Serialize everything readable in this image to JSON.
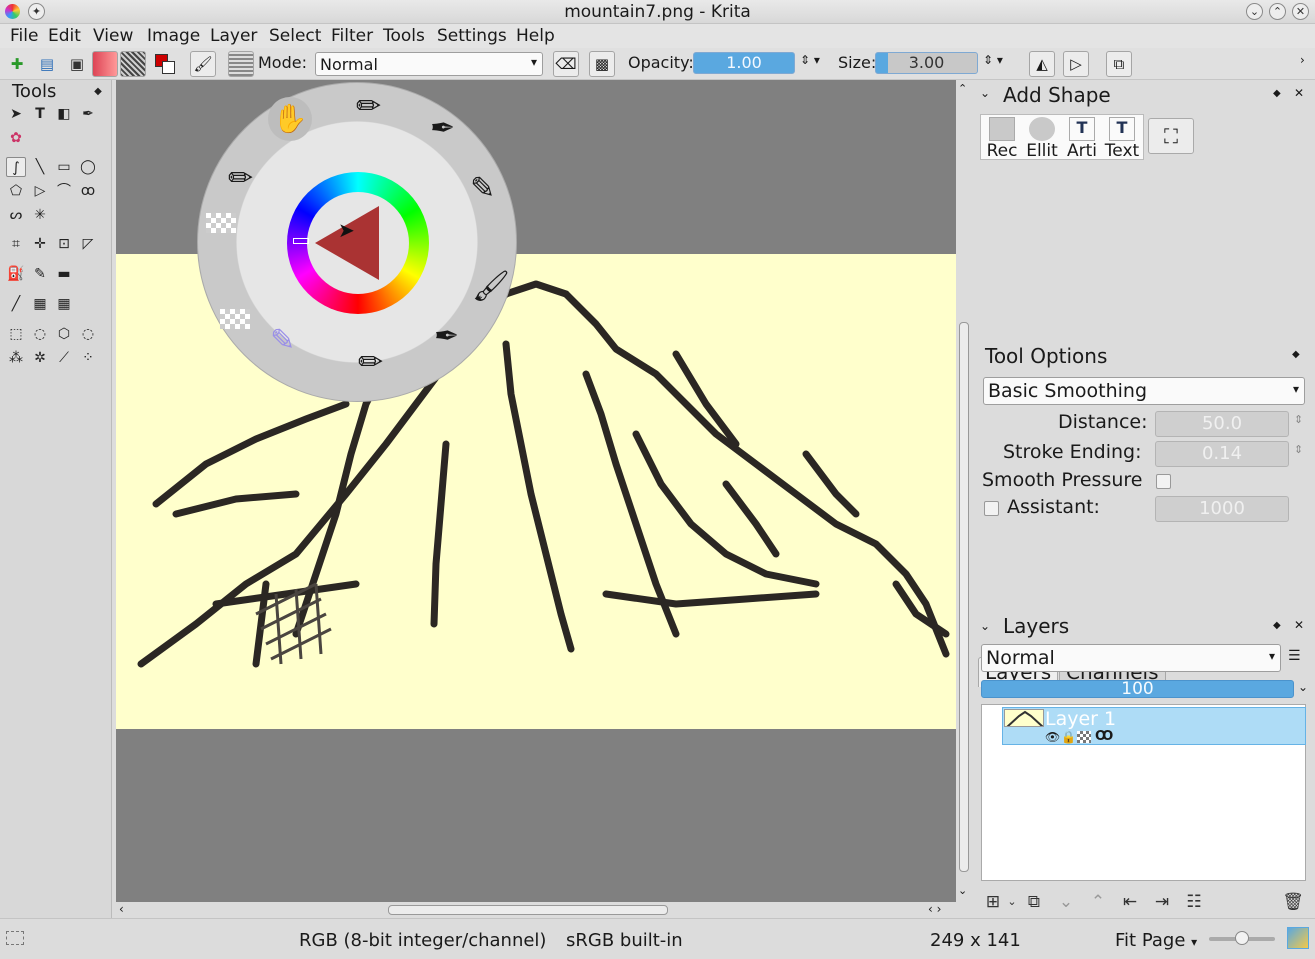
{
  "window": {
    "title": "mountain7.png - Krita"
  },
  "menu": [
    "File",
    "Edit",
    "View",
    "Image",
    "Layer",
    "Select",
    "Filter",
    "Tools",
    "Settings",
    "Help"
  ],
  "toolbar": {
    "mode_label": "Mode:",
    "mode_value": "Normal",
    "opacity_label": "Opacity:",
    "opacity_value": "1.00",
    "size_label": "Size:",
    "size_value": "3.00"
  },
  "tools_dock": {
    "title": "Tools"
  },
  "add_shape": {
    "title": "Add Shape",
    "shapes": [
      "Rec",
      "Ellit",
      "Arti",
      "Text"
    ]
  },
  "tool_options": {
    "title": "Tool Options",
    "smoothing": "Basic Smoothing",
    "distance_label": "Distance:",
    "distance_value": "50.0",
    "stroke_ending_label": "Stroke Ending:",
    "stroke_ending_value": "0.14",
    "smooth_pressure_label": "Smooth Pressure",
    "assistant_label": "Assistant:",
    "assistant_value": "1000"
  },
  "layers_tabs": [
    "Layers",
    "Channels"
  ],
  "layers_dock": {
    "title": "Layers",
    "blend_mode": "Normal",
    "opacity": "100",
    "layers": [
      {
        "name": "Layer 1"
      }
    ]
  },
  "status": {
    "color_model": "RGB (8-bit integer/channel)",
    "profile": "sRGB built-in",
    "dimensions": "249 x 141",
    "zoom": "Fit Page"
  },
  "colors": {
    "canvas_bg": "#808080",
    "image_bg": "#ffffcc",
    "selection": "#aedcf6",
    "accent": "#5aa8e0"
  }
}
